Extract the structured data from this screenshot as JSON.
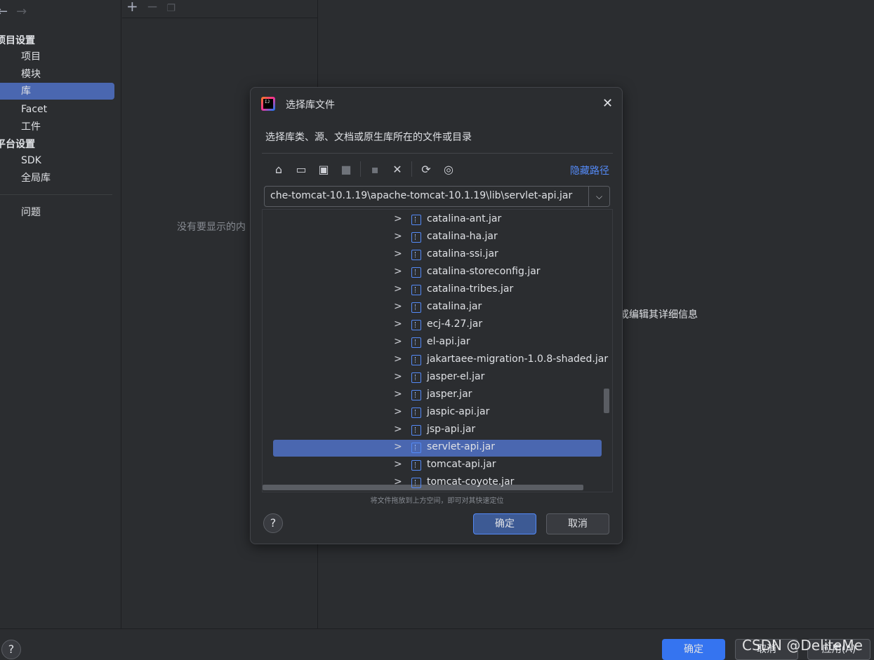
{
  "sidebar": {
    "back_icon": "arrow-left-icon",
    "forward_icon": "arrow-right-icon",
    "sections": [
      {
        "label": "项目设置",
        "items": [
          "项目",
          "模块",
          "库",
          "Facet",
          "工件"
        ]
      },
      {
        "label": "平台设置",
        "items": [
          "SDK",
          "全局库"
        ]
      }
    ],
    "selected_item": "库",
    "extra_item": "问题"
  },
  "middle": {
    "empty_text": "没有要显示的内"
  },
  "right": {
    "hint_text": "或编辑其详细信息"
  },
  "bottom": {
    "ok_label": "确定",
    "cancel_label": "取消",
    "apply_label": "应用(A)",
    "watermark": "CSDN @DeliteMe"
  },
  "dialog": {
    "title": "选择库文件",
    "description": "选择库类、源、文档或原生库所在的文件或目录",
    "hide_path_label": "隐藏路径",
    "path_value": "che-tomcat-10.1.19\\apache-tomcat-10.1.19\\lib\\servlet-api.jar",
    "files": [
      "catalina-ant.jar",
      "catalina-ha.jar",
      "catalina-ssi.jar",
      "catalina-storeconfig.jar",
      "catalina-tribes.jar",
      "catalina.jar",
      "ecj-4.27.jar",
      "el-api.jar",
      "jakartaee-migration-1.0.8-shaded.jar",
      "jasper-el.jar",
      "jasper.jar",
      "jaspic-api.jar",
      "jsp-api.jar",
      "servlet-api.jar",
      "tomcat-api.jar",
      "tomcat-coyote.jar"
    ],
    "selected_file": "servlet-api.jar",
    "drag_hint": "将文件拖放到上方空间，即可对其快速定位",
    "ok_label": "确定",
    "cancel_label": "取消"
  },
  "colors": {
    "background": "#2b2d30",
    "selection": "#4a67b0",
    "primary_button": "#3574f0",
    "link": "#548af7"
  }
}
